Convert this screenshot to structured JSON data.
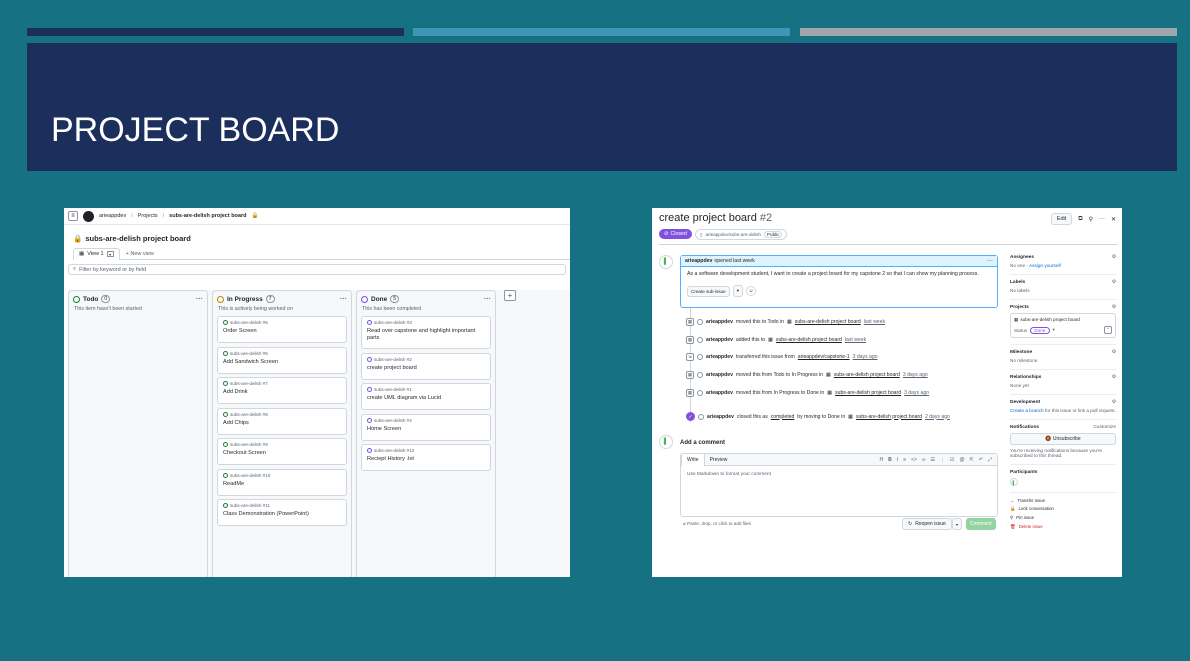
{
  "slide": {
    "title": "PROJECT BOARD",
    "stripe_colors": [
      "#1b2e5c",
      "#3d96b7",
      "#a0a8ae"
    ],
    "background": "#167282"
  },
  "board": {
    "breadcrumb": {
      "user": "arieappdev",
      "sep1": "/",
      "projects": "Projects",
      "sep2": "/",
      "project": "subs-are-delish project board"
    },
    "title": "subs-are-delish project board",
    "view_tab": "View 1",
    "new_view": "New view",
    "filter_placeholder": "Filter by keyword or by field",
    "columns": [
      {
        "name": "Todo",
        "count": "0",
        "color": "#1a7f37",
        "desc": "This item hasn't been started",
        "cards": []
      },
      {
        "name": "In Progress",
        "count": "7",
        "color": "#bf8700",
        "desc": "This is actively being worked on",
        "cards": [
          {
            "repo": "subs-are-delish #5",
            "title": "Order Screen"
          },
          {
            "repo": "subs-are-delish #6",
            "title": "Add Sandwich Screen"
          },
          {
            "repo": "subs-are-delish #7",
            "title": "Add Drink"
          },
          {
            "repo": "subs-are-delish #8",
            "title": "Add Chips"
          },
          {
            "repo": "subs-are-delish #9",
            "title": "Checkout Screen"
          },
          {
            "repo": "subs-are-delish #10",
            "title": "ReadMe"
          },
          {
            "repo": "subs-are-delish #11",
            "title": "Class Demonstration (PowerPoint)"
          }
        ]
      },
      {
        "name": "Done",
        "count": "5",
        "color": "#8250df",
        "desc": "This has been completed",
        "cards": [
          {
            "repo": "subs-are-delish #3",
            "title": "Read over capstone and highlight important parts"
          },
          {
            "repo": "subs-are-delish #2",
            "title": "create project board"
          },
          {
            "repo": "subs-are-delish #1",
            "title": "create UML diagram via Lucid"
          },
          {
            "repo": "subs-are-delish #4",
            "title": "Home Screen"
          },
          {
            "repo": "subs-are-delish #12",
            "title": "Reciept History .txt"
          }
        ]
      }
    ],
    "add_column": "+"
  },
  "issue": {
    "title": "create project board",
    "number": "#2",
    "edit": "Edit",
    "state": "Closed",
    "repo": "arieappdev/subs-are-delish",
    "visibility": "Public",
    "opener": "arieappdev",
    "opened_text": "opened last week",
    "body": "As a software development student, I want to create a project board for my capstone 2 so that I can show my planning process.",
    "create_subissue": "Create sub-issue",
    "timeline": [
      {
        "actor": "arieappdev",
        "text": "moved this to Todo in",
        "link": "subs-are-delish project board",
        "time": "last week"
      },
      {
        "actor": "arieappdev",
        "text": "added this to",
        "link": "subs-are-delish project board",
        "time": "last week"
      },
      {
        "actor": "arieappdev",
        "text": "transferred this issue from",
        "link": "arieappdev/capstone-1",
        "time": "3 days ago"
      },
      {
        "actor": "arieappdev",
        "text": "moved this from Todo to In Progress in",
        "link": "subs-are-delish project board",
        "time": "3 days ago"
      },
      {
        "actor": "arieappdev",
        "text": "moved this from In Progress to Done in",
        "link": "subs-are-delish project board",
        "time": "3 days ago"
      },
      {
        "actor": "arieappdev",
        "text": "closed this as",
        "extra": "completed",
        "text2": "by moving to Done in",
        "link": "subs-are-delish project board",
        "time": "2 days ago"
      }
    ],
    "add_comment": "Add a comment",
    "tab_write": "Write",
    "tab_preview": "Preview",
    "editor_placeholder": "Use Markdown to format your comment",
    "paste_hint": "Paste, drop, or click to add files",
    "reopen": "Reopen issue",
    "comment_btn": "Comment",
    "sidebar": {
      "assignees": "Assignees",
      "assignees_val": "No one -",
      "assign_yourself": "Assign yourself",
      "labels": "Labels",
      "labels_val": "No labels",
      "projects": "Projects",
      "project_name": "subs-are-delish project board",
      "status_label": "Status",
      "status_val": "Done",
      "milestone": "Milestone",
      "milestone_val": "No milestone",
      "relationships": "Relationships",
      "relationships_val": "None yet",
      "development": "Development",
      "dev_link": "Create a branch",
      "dev_val": "for this issue or link a pull request.",
      "notifications": "Notifications",
      "customize": "Customize",
      "unsubscribe": "Unsubscribe",
      "notif_text": "You're receiving notifications because you're subscribed to this thread.",
      "participants": "Participants",
      "transfer": "Transfer issue",
      "lock": "Lock conversation",
      "pin": "Pin issue",
      "delete": "Delete issue"
    }
  }
}
